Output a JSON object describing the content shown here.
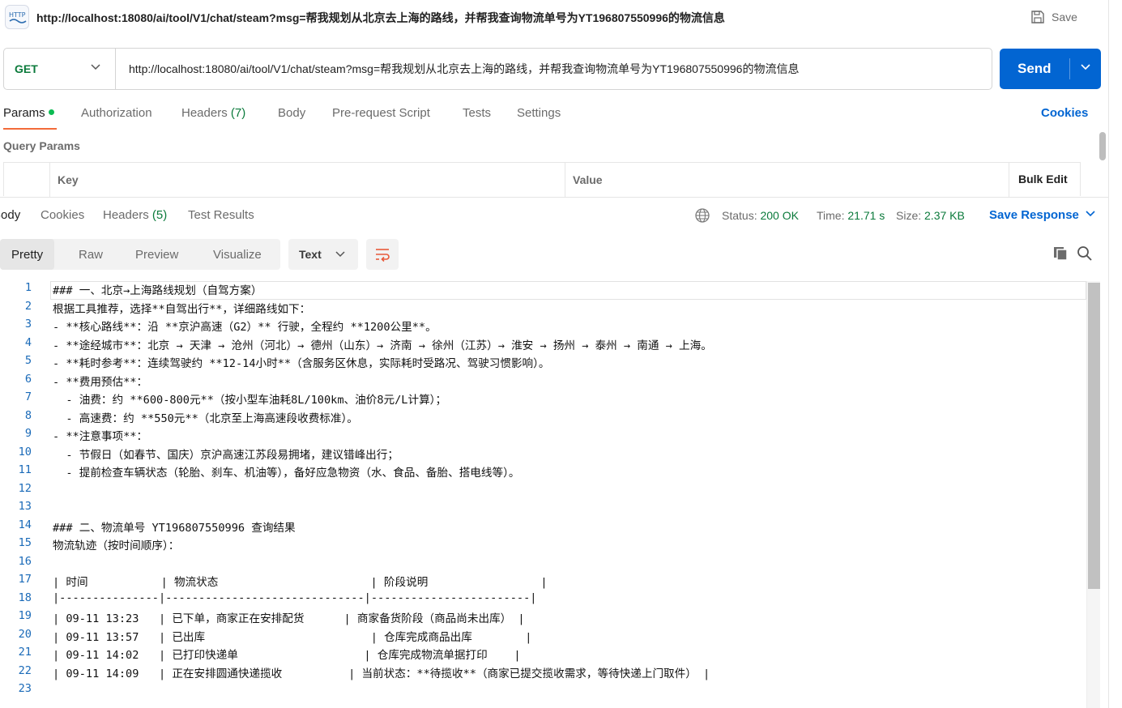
{
  "titlebar": {
    "icon_label": "HTTP",
    "title": "http://localhost:18080/ai/tool/V1/chat/steam?msg=帮我规划从北京去上海的路线，并帮我查询物流单号为YT196807550996的物流信息",
    "save_label": "Save"
  },
  "request": {
    "method": "GET",
    "url": "http://localhost:18080/ai/tool/V1/chat/steam?msg=帮我规划从北京去上海的路线，并帮我查询物流单号为YT196807550996的物流信息",
    "send_label": "Send"
  },
  "request_tabs": {
    "params": "Params",
    "authorization": "Authorization",
    "headers": "Headers",
    "headers_count": "(7)",
    "body": "Body",
    "prerequest": "Pre-request Script",
    "tests": "Tests",
    "settings": "Settings",
    "cookies": "Cookies"
  },
  "query_params": {
    "title": "Query Params",
    "key_header": "Key",
    "value_header": "Value",
    "bulk_edit": "Bulk Edit"
  },
  "response_tabs": {
    "body": "Body",
    "cookies": "Cookies",
    "headers": "Headers",
    "headers_count": "(5)",
    "test_results": "Test Results"
  },
  "response_meta": {
    "status_label": "Status:",
    "status_value": "200 OK",
    "time_label": "Time:",
    "time_value": "21.71 s",
    "size_label": "Size:",
    "size_value": "2.37 KB",
    "save_response": "Save Response"
  },
  "view_modes": {
    "pretty": "Pretty",
    "raw": "Raw",
    "preview": "Preview",
    "visualize": "Visualize",
    "format": "Text"
  },
  "icons": {
    "http": "http-request-icon",
    "save": "save-icon",
    "globe": "globe-icon",
    "wrap": "wrap-lines-icon",
    "copy": "copy-icon",
    "search": "search-icon",
    "chevron": "chevron-down-icon"
  },
  "colors": {
    "accent_blue": "#0265d2",
    "status_green": "#0b7a3b",
    "active_tab_underline": "#f26b3a",
    "wrap_icon": "#e8593a"
  },
  "editor_lines": [
    {
      "n": "1",
      "t": "### 一、北京→上海路线规划（自驾方案）"
    },
    {
      "n": "2",
      "t": "根据工具推荐，选择**自驾出行**，详细路线如下："
    },
    {
      "n": "3",
      "t": "- **核心路线**：沿 **京沪高速（G2）** 行驶，全程约 **1200公里**。"
    },
    {
      "n": "4",
      "t": "- **途经城市**：北京 → 天津 → 沧州（河北）→ 德州（山东）→ 济南 → 徐州（江苏）→ 淮安 → 扬州 → 泰州 → 南通 → 上海。"
    },
    {
      "n": "5",
      "t": "- **耗时参考**：连续驾驶约 **12-14小时**（含服务区休息，实际耗时受路况、驾驶习惯影响）。"
    },
    {
      "n": "6",
      "t": "- **费用预估**："
    },
    {
      "n": "7",
      "t": "  - 油费：约 **600-800元**（按小型车油耗8L/100km、油价8元/L计算）；"
    },
    {
      "n": "8",
      "t": "  - 高速费：约 **550元**（北京至上海高速段收费标准）。"
    },
    {
      "n": "9",
      "t": "- **注意事项**："
    },
    {
      "n": "10",
      "t": "  - 节假日（如春节、国庆）京沪高速江苏段易拥堵，建议错峰出行；"
    },
    {
      "n": "11",
      "t": "  - 提前检查车辆状态（轮胎、刹车、机油等），备好应急物资（水、食品、备胎、搭电线等）。"
    },
    {
      "n": "12",
      "t": ""
    },
    {
      "n": "13",
      "t": ""
    },
    {
      "n": "14",
      "t": "### 二、物流单号 YT196807550996 查询结果"
    },
    {
      "n": "15",
      "t": "物流轨迹（按时间顺序）："
    },
    {
      "n": "16",
      "t": ""
    },
    {
      "n": "17",
      "t": "| 时间           | 物流状态                       | 阶段说明                 |"
    },
    {
      "n": "18",
      "t": "|---------------|------------------------------|------------------------|"
    },
    {
      "n": "19",
      "t": "| 09-11 13:23   | 已下单，商家正在安排配货      | 商家备货阶段（商品尚未出库） |"
    },
    {
      "n": "20",
      "t": "| 09-11 13:57   | 已出库                         | 仓库完成商品出库        |"
    },
    {
      "n": "21",
      "t": "| 09-11 14:02   | 已打印快递单                   | 仓库完成物流单据打印    |"
    },
    {
      "n": "22",
      "t": "| 09-11 14:09   | 正在安排圆通快递揽收          | 当前状态：**待揽收**（商家已提交揽收需求，等待快递上门取件） |"
    },
    {
      "n": "23",
      "t": ""
    }
  ]
}
